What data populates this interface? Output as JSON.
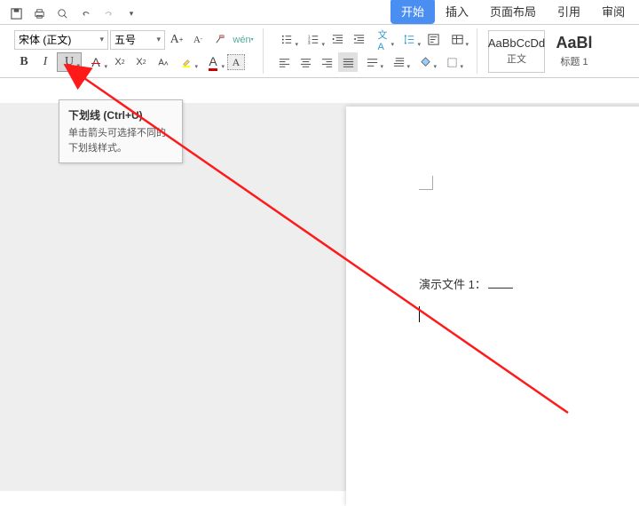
{
  "qat": {
    "items": [
      "save",
      "print",
      "undo",
      "redo",
      "dropdown"
    ]
  },
  "tabs": {
    "active": "开始",
    "items": [
      "开始",
      "插入",
      "页面布局",
      "引用",
      "审阅"
    ]
  },
  "font": {
    "name": "宋体 (正文)",
    "size": "五号"
  },
  "group2_row1_icons": [
    "increase-font",
    "decrease-font",
    "clear-format",
    "phonetic"
  ],
  "format_row": {
    "bold": "B",
    "italic": "I",
    "underline": "U"
  },
  "group2_row2_icons": [
    "strikethrough",
    "superscript",
    "subscript",
    "change-case",
    "highlight",
    "font-color",
    "char-border"
  ],
  "para_row1_icons": [
    "bullets",
    "numbering",
    "multilevel",
    "decrease-indent",
    "increase-indent",
    "text-direction",
    "line-spacing",
    "sort",
    "show-marks"
  ],
  "para_row2_icons": [
    "align-left",
    "align-center",
    "align-right",
    "justify",
    "distribute",
    "indent-left",
    "indent-right",
    "shading",
    "borders"
  ],
  "styles": [
    {
      "preview": "AaBbCcDd",
      "label": "正文"
    },
    {
      "preview": "AaBl",
      "label": "标题 1"
    }
  ],
  "tooltip": {
    "title": "下划线 (Ctrl+U)",
    "body": "单击箭头可选择不同的下划线样式。"
  },
  "document": {
    "title_text": "演示文件 1："
  }
}
